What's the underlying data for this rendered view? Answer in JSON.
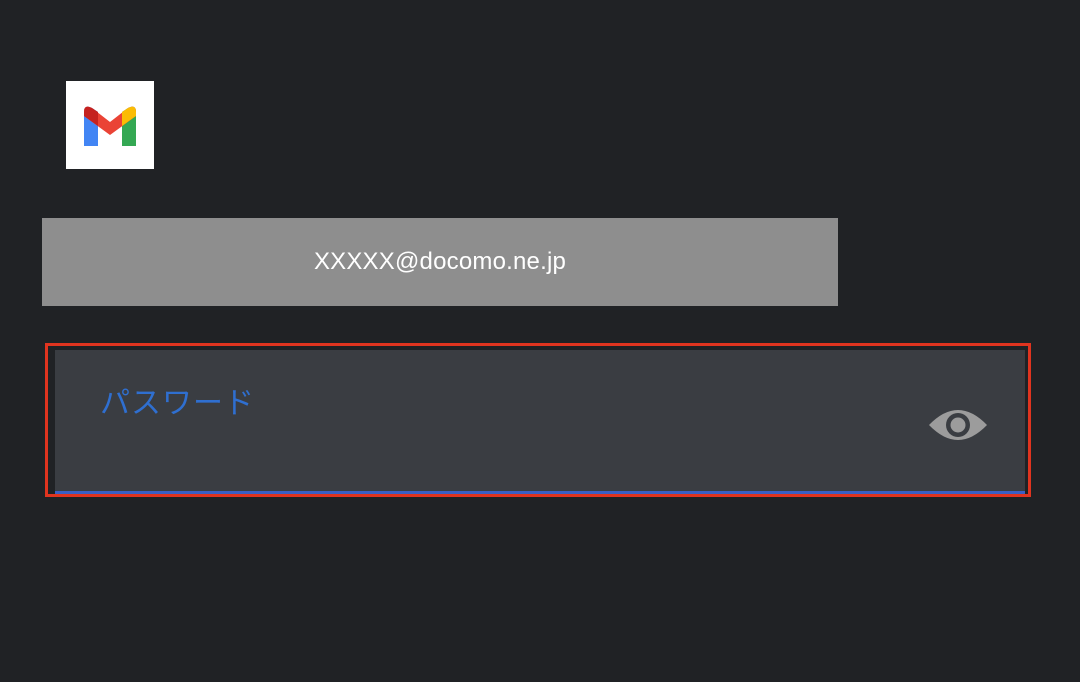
{
  "logo": {
    "icon": "gmail-logo-icon",
    "colors": {
      "red": "#ea4335",
      "blue": "#4285f4",
      "green": "#34a853",
      "yellow": "#fbbc04",
      "dark_red": "#c5221f"
    }
  },
  "email": {
    "value": "XXXXX@docomo.ne.jp"
  },
  "password_field": {
    "label": "パスワード",
    "value": "",
    "toggle_icon": "eye-icon"
  },
  "colors": {
    "background": "#202225",
    "highlight": "#e0341f",
    "label": "#2f6fd0",
    "field_bg": "#3a3d42"
  }
}
